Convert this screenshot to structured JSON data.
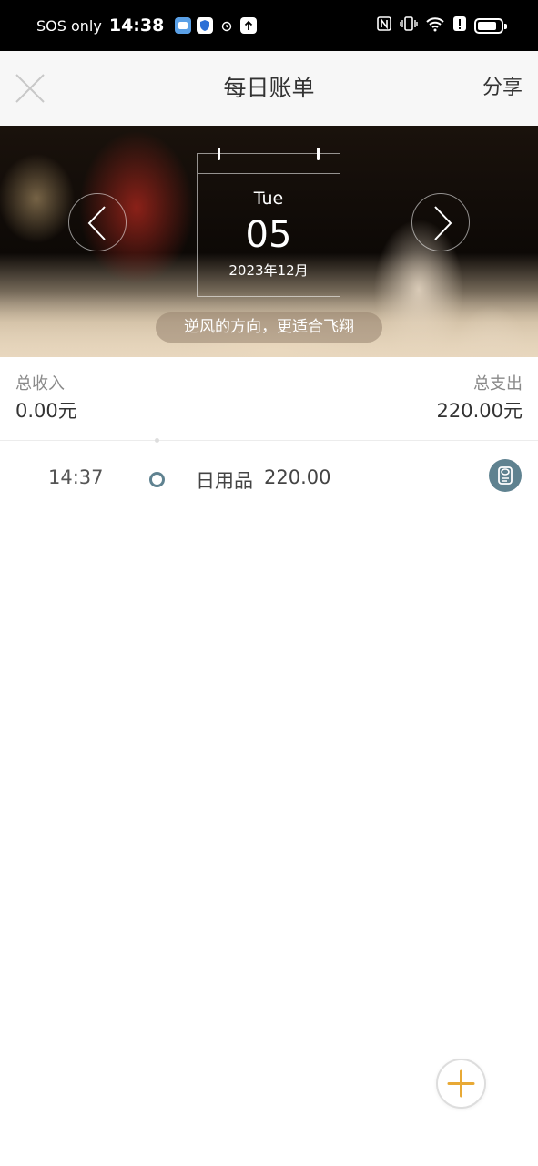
{
  "status_bar": {
    "carrier": "SOS only",
    "time": "14:38",
    "icons": [
      "app-notification-icon",
      "shield-icon",
      "alarm-icon",
      "upload-icon",
      "nfc-icon",
      "vibrate-icon",
      "wifi-icon",
      "alert-icon",
      "battery-icon"
    ]
  },
  "header": {
    "title": "每日账单",
    "share_label": "分享",
    "close_icon": "close-icon"
  },
  "banner": {
    "weekday": "Tue",
    "day": "05",
    "month_label": "2023年12月",
    "quote": "逆风的方向，更适合飞翔",
    "prev_icon": "chevron-left-icon",
    "next_icon": "chevron-right-icon"
  },
  "summary": {
    "income_label": "总收入",
    "income_value": "0.00元",
    "expense_label": "总支出",
    "expense_value": "220.00元"
  },
  "entries": [
    {
      "time": "14:37",
      "category": "日用品",
      "amount": "220.00",
      "icon": "tissue-roll-icon"
    }
  ],
  "fab": {
    "icon": "plus-icon"
  },
  "colors": {
    "accent_fab": "#e8a935",
    "timeline_dot": "#5f8290",
    "header_bg": "#f7f7f7"
  }
}
